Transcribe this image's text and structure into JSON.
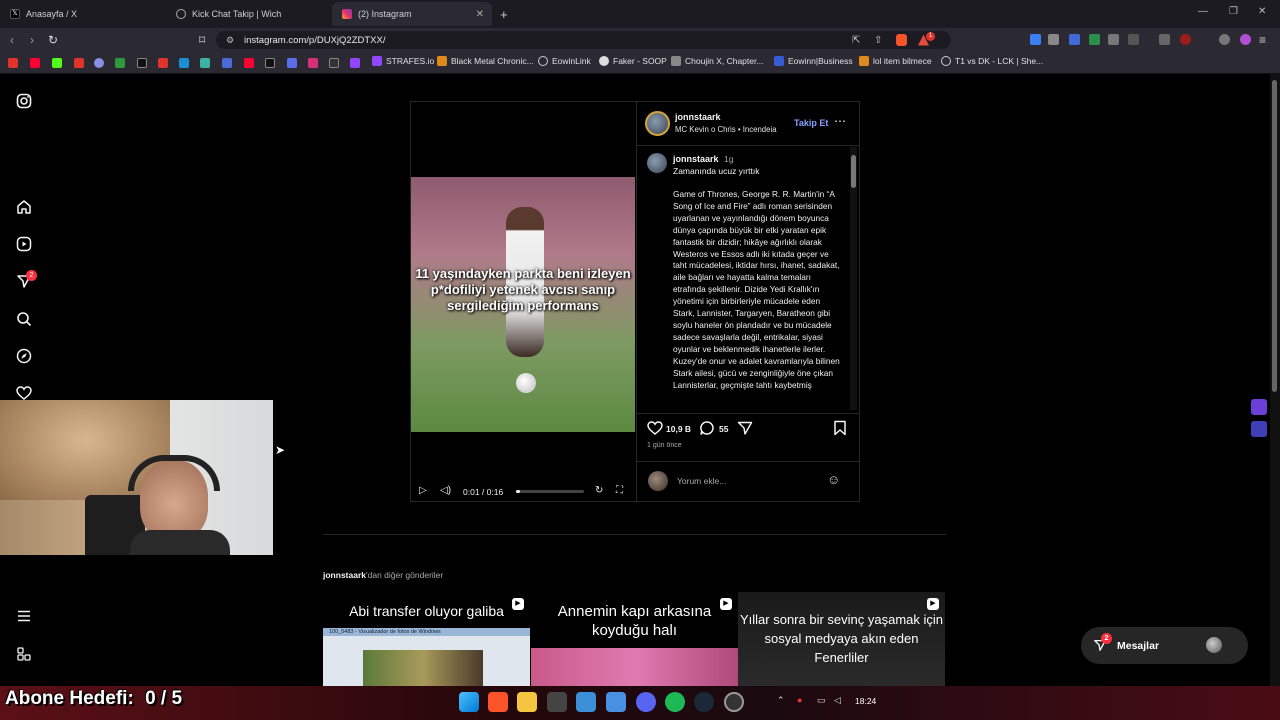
{
  "browser": {
    "tabs": [
      {
        "label": "Anasayfa / X",
        "active": false
      },
      {
        "label": "Kick Chat Takip | Wich",
        "active": false
      },
      {
        "label": "(2) Instagram",
        "active": true
      }
    ],
    "url": "instagram.com/p/DUXjQ2ZDTXX/",
    "bookmarks": [
      "STRAFES.io",
      "Black Metal Chronic...",
      "EowinLink",
      "Faker - SOOP",
      "Choujin X, Chapter...",
      "Eowinn|Business",
      "lol item bilmece",
      "T1 vs DK - LCK | She..."
    ],
    "extension_badge": "1"
  },
  "sidebar": {
    "notification_badge": "2",
    "icons": [
      "instagram-icon",
      "home-icon",
      "reels-icon",
      "direct-icon",
      "search-icon",
      "explore-icon",
      "heart-icon",
      "menu-icon",
      "more-icon"
    ]
  },
  "post": {
    "username": "jonnstaark",
    "audio": "MC Kevin o Chris • Incendeia",
    "follow_label": "Takip Et",
    "video_overlay_text": "11 yaşındayken parkta beni izleyen p*dofiliyi yetenek avcısı sanıp sergilediğim performans",
    "video_time": "0:01 / 0:16",
    "video_progress": 0.06,
    "caption_user": "jonnstaark",
    "caption_age": "1g",
    "caption_title": "Zamanında ucuz yırttık",
    "caption_body": "Game of Thrones, George R. R. Martin'in “A Song of Ice and Fire” adlı roman serisinden uyarlanan ve yayınlandığı dönem boyunca dünya çapında büyük bir etki yaratan epik fantastik bir dizidir; hikâye ağırlıklı olarak Westeros ve Essos adlı iki kıtada geçer ve taht mücadelesi, iktidar hırsı, ihanet, sadakat, aile bağları ve hayatta kalma temaları etrafında şekillenir. Dizide Yedi Krallık'ın yönetimi için birbirleriyle mücadele eden Stark, Lannister, Targaryen, Baratheon gibi soylu haneler ön plandadır ve bu mücadele sadece savaşlarla değil, entrikalar, siyasi oyunlar ve beklenmedik ihanetlerle ilerler. Kuzey'de onur ve adalet kavramlarıyla bilinen Stark ailesi, gücü ve zenginliğiyle öne çıkan Lannisterlar, geçmişte tahtı kaybetmiş",
    "likes": "10,9 B",
    "comments": "55",
    "posted_ago": "1 gün önce",
    "comment_placeholder": "Yorum ekle..."
  },
  "more_posts": {
    "heading_user": "jonnstaark",
    "heading_rest": "'dan diğer gönderiler",
    "items": [
      {
        "caption": "Abi transfer oluyor galiba",
        "window_title": "100_5483 - Visualizador de fotos de Windows"
      },
      {
        "caption": "Annemin kapı arkasına koyduğu halı"
      },
      {
        "caption": "Yıllar sonra bir sevinç yaşamak için sosyal medyaya akın eden Fenerliler"
      }
    ]
  },
  "messages": {
    "label": "Mesajlar",
    "badge": "2"
  },
  "overlay": {
    "sub_goal": "Abone Hedefi:",
    "sub_count": "0 / 5"
  },
  "taskbar": {
    "time": "18:24"
  },
  "colors": {
    "accent_link": "#85a1ff",
    "badge": "#ff3040",
    "bg": "#000000"
  }
}
